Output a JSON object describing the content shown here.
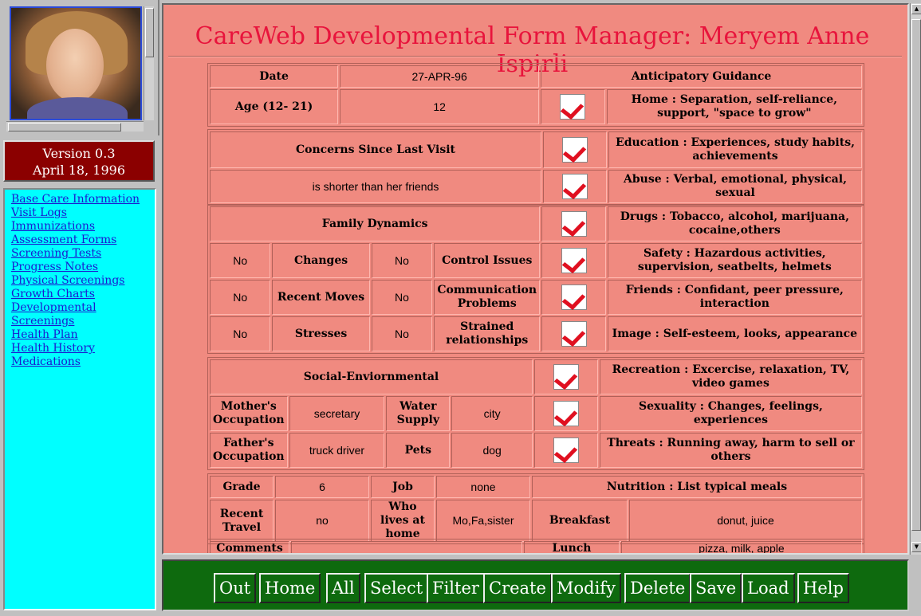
{
  "window": {
    "title": "CareWeb Developmental Form Manager: Meryem Anne Ispirli"
  },
  "sidebar": {
    "version": "Version 0.3",
    "date": "April 18, 1996",
    "links": [
      "Base Care Information",
      "Visit Logs",
      "Immunizations",
      "Assessment Forms",
      "Screening Tests",
      "Progress Notes",
      "Physical Screenings",
      "Growth Charts",
      "Developmental",
      "Screenings",
      "Health Plan",
      "Health History",
      "Medications"
    ]
  },
  "header": {
    "date_label": "Date",
    "date_value": "27-APR-96",
    "age_label": "Age (12- 21)",
    "age_value": "12",
    "guidance_title": "Anticipatory Guidance"
  },
  "guidance": {
    "home": "Home : Separation, self-reliance, support, \"space to grow\"",
    "education": "Education : Experiences, study habits, achievements",
    "abuse": "Abuse : Verbal, emotional, physical, sexual",
    "drugs": "Drugs : Tobacco, alcohol, marijuana, cocaine,others",
    "safety": "Safety : Hazardous activities, supervision, seatbelts, helmets",
    "friends": "Friends : Confidant, peer pressure, interaction",
    "image": "Image : Self-esteem, looks, appearance",
    "recreation": "Recreation : Excercise, relaxation, TV, video games",
    "sexuality": "Sexuality : Changes, feelings, experiences",
    "threats": "Threats : Running away, harm to sell or others",
    "nutrition": "Nutrition : List typical meals"
  },
  "concerns": {
    "label": "Concerns Since Last Visit",
    "value": "is shorter than her friends"
  },
  "family": {
    "label": "Family Dynamics",
    "rows": [
      {
        "v1": "No",
        "l1": "Changes",
        "v2": "No",
        "l2": "Control Issues"
      },
      {
        "v1": "No",
        "l1": "Recent Moves",
        "v2": "No",
        "l2": "Communication Problems"
      },
      {
        "v1": "No",
        "l1": "Stresses",
        "v2": "No",
        "l2": "Strained relationships"
      }
    ]
  },
  "social": {
    "label": "Social-Enviornmental",
    "mother_label": "Mother's Occupation",
    "mother_value": "secretary",
    "water_label": "Water Supply",
    "water_value": "city",
    "father_label": "Father's Occupation",
    "father_value": "truck driver",
    "pets_label": "Pets",
    "pets_value": "dog"
  },
  "school": {
    "grade_label": "Grade",
    "grade_value": "6",
    "job_label": "Job",
    "job_value": "none",
    "travel_label": "Recent Travel",
    "travel_value": "no",
    "lives_label": "Who lives at home",
    "lives_value": "Mo,Fa,sister",
    "breakfast_label": "Breakfast",
    "breakfast_value": "donut, juice",
    "comments_label": "Comments",
    "lunch_label": "Lunch",
    "lunch_value": "pizza, milk, apple"
  },
  "toolbar": {
    "buttons": [
      "Out",
      "Home",
      "All",
      "Select",
      "Filter",
      "Create",
      "Modify",
      "Delete",
      "Save",
      "Load",
      "Help"
    ]
  },
  "colors": {
    "main_bg": "#f08a80",
    "title": "#e8143c",
    "nav_bg": "#00ffff",
    "toolbar_bg": "#0e6a0e",
    "version_bg": "#8b0000"
  }
}
